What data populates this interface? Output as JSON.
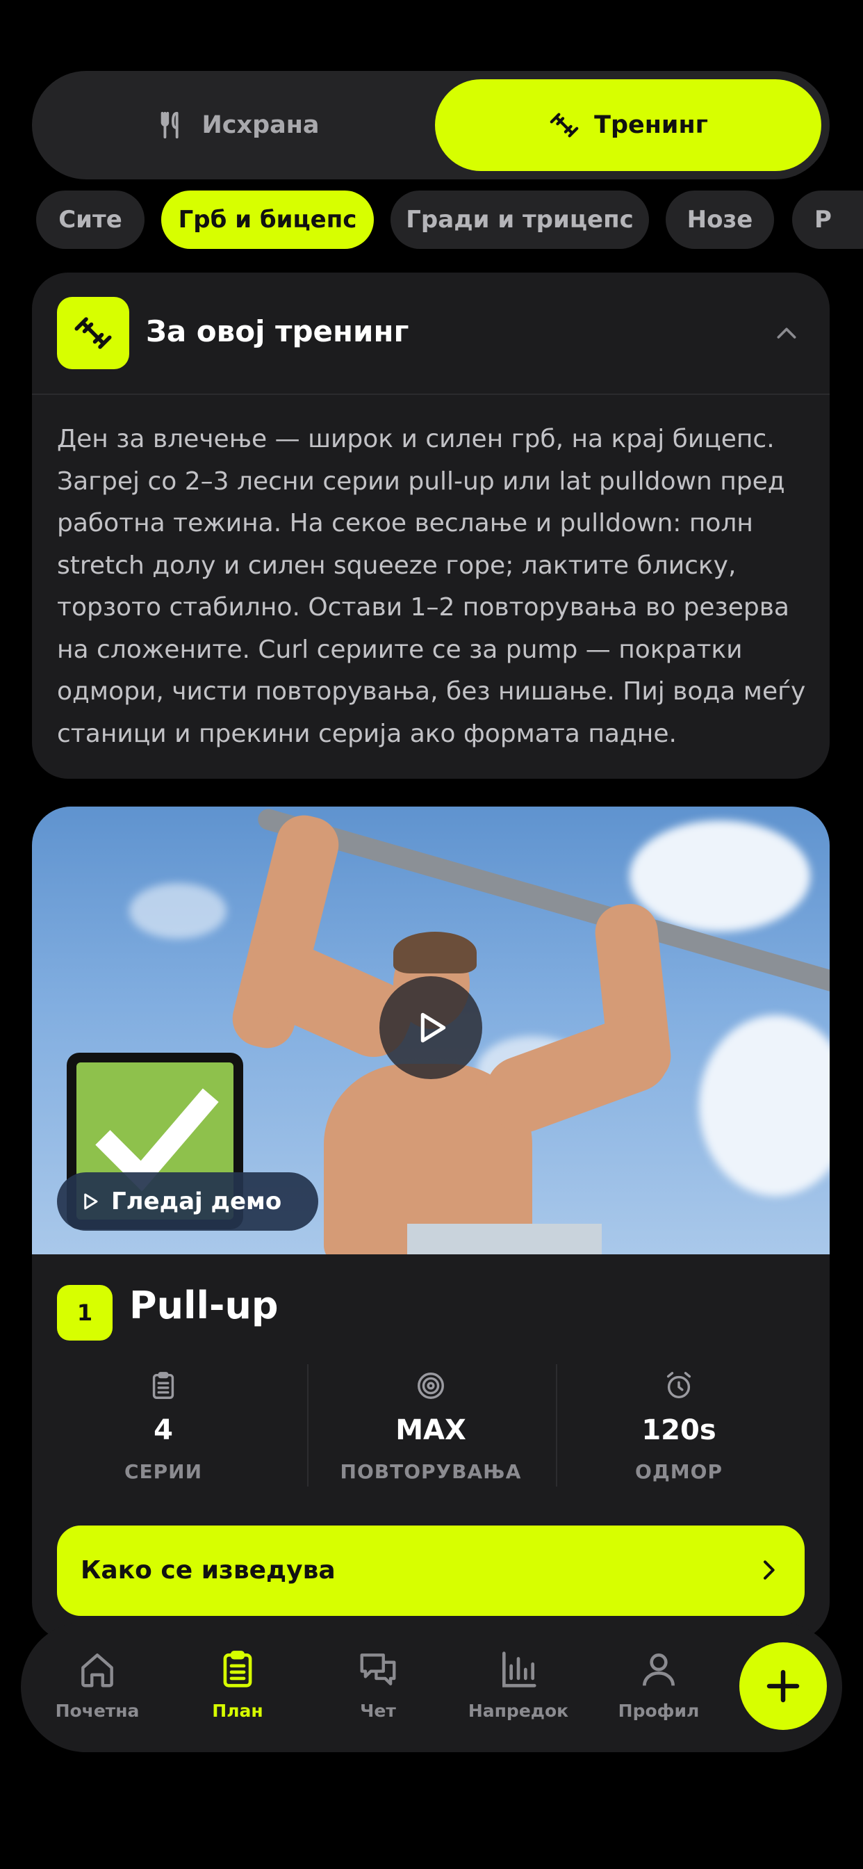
{
  "segment": {
    "nutrition": "Исхрана",
    "training": "Тренинг"
  },
  "chips": [
    "Сите",
    "Грб и бицепс",
    "Гради и трицепс",
    "Нозе",
    "Р"
  ],
  "info": {
    "title": "За овој тренинг",
    "text": "Ден за влечење — широк и силен грб, на крај бицепс. Загреј со 2–3 лесни серии pull-up или lat pulldown пред работна тежина. На секое веслање и pulldown: полн stretch долу и силен squeeze горе; лактите блиску, торзото стабилно. Остави 1–2 повторувања во резерва на сложените. Curl сериите се за pump — пократки одмори, чисти повторувања, без нишање. Пиј вода меѓу станици и прекини серија ако формата падне."
  },
  "exercise": {
    "demo_label": "Гледај демо",
    "number": "1",
    "title": "Pull-up",
    "stats": [
      {
        "value": "4",
        "label": "СЕРИИ",
        "icon": "clipboard-icon"
      },
      {
        "value": "MAX",
        "label": "ПОВТОРУВАЊА",
        "icon": "target-icon"
      },
      {
        "value": "120s",
        "label": "ОДМОР",
        "icon": "alarm-icon"
      }
    ],
    "how_label": "Како се изведува"
  },
  "nav": [
    "Почетна",
    "План",
    "Чет",
    "Напредок",
    "Профил"
  ],
  "colors": {
    "accent": "#d7ff00",
    "card": "#1c1c1e",
    "background": "#000000"
  }
}
